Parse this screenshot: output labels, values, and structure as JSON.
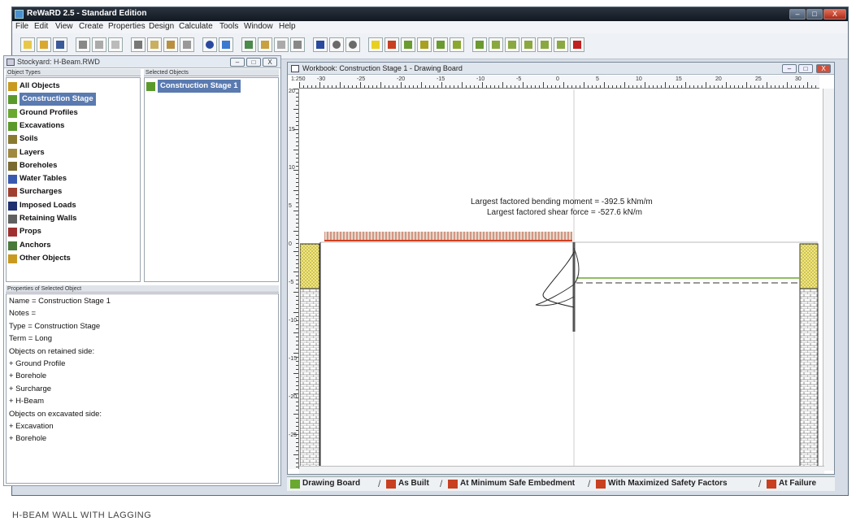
{
  "app": {
    "title": "ReWaRD 2.5 - Standard Edition",
    "window_buttons": {
      "minimize": "–",
      "maximize": "□",
      "close": "X"
    }
  },
  "menu": [
    "File",
    "Edit",
    "View",
    "Create",
    "Properties",
    "Design",
    "Calculate",
    "Tools",
    "Window",
    "Help"
  ],
  "stockyard": {
    "title": "Stockyard: H-Beam.RWD",
    "object_types_label": "Object Types",
    "selected_objects_label": "Selected Objects",
    "object_types": [
      {
        "label": "All Objects",
        "icon": "all-objects-icon",
        "color": "#c89a20"
      },
      {
        "label": "Construction Stage",
        "icon": "construction-stage-icon",
        "color": "#5a9a2a",
        "selected": true
      },
      {
        "label": "Ground Profiles",
        "icon": "ground-profiles-icon",
        "color": "#6aa830"
      },
      {
        "label": "Excavations",
        "icon": "excavations-icon",
        "color": "#5a9a2a"
      },
      {
        "label": "Soils",
        "icon": "soils-icon",
        "color": "#8a7a30"
      },
      {
        "label": "Layers",
        "icon": "layers-icon",
        "color": "#a08a40"
      },
      {
        "label": "Boreholes",
        "icon": "boreholes-icon",
        "color": "#7a6a30"
      },
      {
        "label": "Water Tables",
        "icon": "water-tables-icon",
        "color": "#3a5ab0"
      },
      {
        "label": "Surcharges",
        "icon": "surcharges-icon",
        "color": "#a04030"
      },
      {
        "label": "Imposed Loads",
        "icon": "imposed-loads-icon",
        "color": "#203070"
      },
      {
        "label": "Retaining Walls",
        "icon": "retaining-walls-icon",
        "color": "#606060"
      },
      {
        "label": "Props",
        "icon": "props-icon",
        "color": "#a03030"
      },
      {
        "label": "Anchors",
        "icon": "anchors-icon",
        "color": "#4a7a3a"
      },
      {
        "label": "Other Objects",
        "icon": "other-objects-icon",
        "color": "#c89a20"
      }
    ],
    "selected_objects": [
      {
        "label": "Construction Stage 1",
        "icon": "construction-stage-icon"
      }
    ],
    "properties_label": "Properties of Selected Object",
    "properties": [
      "Name = Construction Stage 1",
      "Notes =",
      "Type = Construction Stage",
      "Term = Long",
      "Objects on retained side:",
      "+ Ground Profile",
      "+ Borehole",
      "+ Surcharge",
      "+ H-Beam",
      "Objects on excavated side:",
      "+ Excavation",
      "+ Borehole"
    ]
  },
  "board": {
    "title": "Workbook: Construction Stage 1 - Drawing Board",
    "scale": "1:250",
    "hruler_ticks": [
      "-30",
      "-25",
      "-20",
      "-15",
      "-10",
      "-5",
      "0",
      "5",
      "10",
      "15",
      "20",
      "25",
      "30"
    ],
    "vruler_ticks": [
      "20",
      "15",
      "10",
      "5",
      "0",
      "-5",
      "-10",
      "-15",
      "-20",
      "-25"
    ],
    "annotation_1": "Largest factored bending moment = -392.5 kNm/m",
    "annotation_2": "Largest factored shear force = -527.6 kN/m"
  },
  "tabs": [
    {
      "label": "Drawing Board",
      "active": true
    },
    {
      "label": "As Built"
    },
    {
      "label": "At Minimum Safe Embedment"
    },
    {
      "label": "With Maximized Safety Factors"
    },
    {
      "label": "At Failure"
    }
  ],
  "caption": "H-BEAM WALL WITH LAGGING"
}
